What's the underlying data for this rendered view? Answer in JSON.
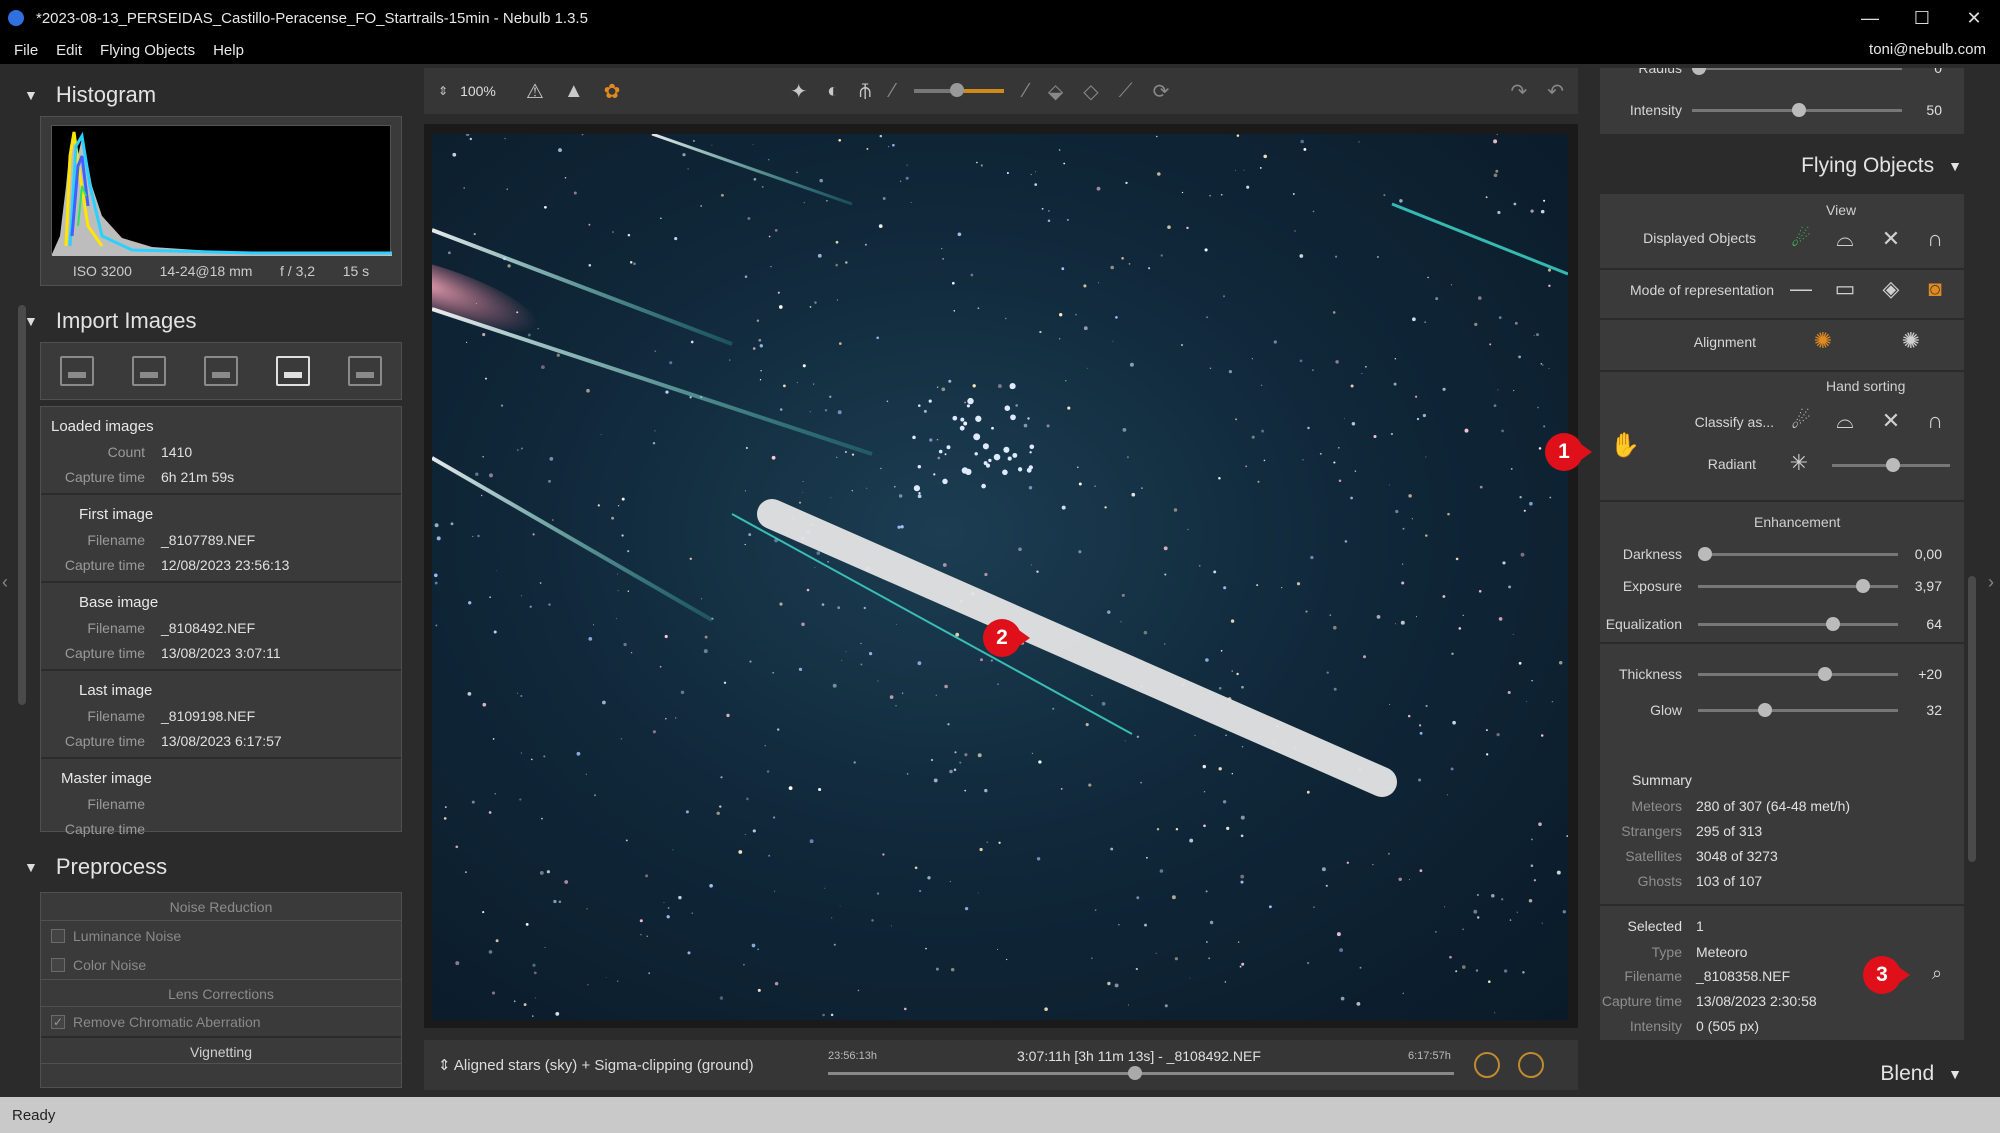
{
  "window": {
    "title": "*2023-08-13_PERSEIDAS_Castillo-Peracense_FO_Startrails-15min - Nebulb 1.3.5",
    "minimize": "—",
    "maximize": "☐",
    "close": "✕"
  },
  "menu": {
    "file": "File",
    "edit": "Edit",
    "flying_objects": "Flying Objects",
    "help": "Help",
    "user": "toni@nebulb.com"
  },
  "histogram": {
    "title": "Histogram",
    "iso": "ISO 3200",
    "lens": "14-24@18 mm",
    "aperture": "f / 3,2",
    "exposure": "15 s"
  },
  "import": {
    "title": "Import Images",
    "loaded": {
      "title": "Loaded images",
      "count_label": "Count",
      "count": "1410",
      "capture_label": "Capture time",
      "capture": "6h 21m 59s"
    },
    "first": {
      "title": "First image",
      "filename_label": "Filename",
      "filename": "_8107789.NEF",
      "capture_label": "Capture time",
      "capture": "12/08/2023 23:56:13"
    },
    "base": {
      "title": "Base image",
      "filename_label": "Filename",
      "filename": "_8108492.NEF",
      "capture_label": "Capture time",
      "capture": "13/08/2023 3:07:11"
    },
    "last": {
      "title": "Last image",
      "filename_label": "Filename",
      "filename": "_8109198.NEF",
      "capture_label": "Capture time",
      "capture": "13/08/2023 6:17:57"
    },
    "master": {
      "title": "Master image",
      "filename_label": "Filename",
      "capture_label": "Capture time"
    }
  },
  "preprocess": {
    "title": "Preprocess",
    "noise_title": "Noise Reduction",
    "luminance": "Luminance Noise",
    "color": "Color Noise",
    "lens_title": "Lens Corrections",
    "chromatic": "Remove Chromatic Aberration",
    "vignetting": "Vignetting"
  },
  "toolbar": {
    "zoom": "100%"
  },
  "bottom": {
    "mode": "Aligned stars (sky) + Sigma-clipping (ground)",
    "start": "23:56:13h",
    "current": "3:07:11h [3h 11m 13s] - _8108492.NEF",
    "end": "6:17:57h",
    "timeline_position": 0.49
  },
  "right": {
    "radius_label": "Radius",
    "radius_value": "0",
    "intensity_label": "Intensity",
    "intensity_value": "50",
    "flying_title": "Flying Objects",
    "view_title": "View",
    "displayed_label": "Displayed Objects",
    "mode_label": "Mode of representation",
    "alignment_label": "Alignment",
    "hand_title": "Hand sorting",
    "classify_label": "Classify as...",
    "radiant_label": "Radiant",
    "enh_title": "Enhancement",
    "darkness_label": "Darkness",
    "darkness_value": "0,00",
    "exposure_label": "Exposure",
    "exposure_value": "3,97",
    "equalization_label": "Equalization",
    "equalization_value": "64",
    "thickness_label": "Thickness",
    "thickness_value": "+20",
    "glow_label": "Glow",
    "glow_value": "32",
    "summary_title": "Summary",
    "meteors_label": "Meteors",
    "meteors_value": "280 of 307 (64-48 met/h)",
    "strangers_label": "Strangers",
    "strangers_value": "295 of 313",
    "satellites_label": "Satellites",
    "satellites_value": "3048 of 3273",
    "ghosts_label": "Ghosts",
    "ghosts_value": "103 of 107",
    "selected_label": "Selected",
    "selected_value": "1",
    "type_label": "Type",
    "type_value": "Meteoro",
    "filename_label": "Filename",
    "filename_value": "_8108358.NEF",
    "capture_label": "Capture time",
    "capture_value": "13/08/2023 2:30:58",
    "sel_intensity_label": "Intensity",
    "sel_intensity_value": "0 (505 px)",
    "blend_title": "Blend"
  },
  "callouts": {
    "one": "1",
    "two": "2",
    "three": "3"
  },
  "status": {
    "text": "Ready"
  },
  "colors": {
    "accent_orange": "#e08a20",
    "callout_red": "#e0101a",
    "active_green": "#3fc060"
  }
}
